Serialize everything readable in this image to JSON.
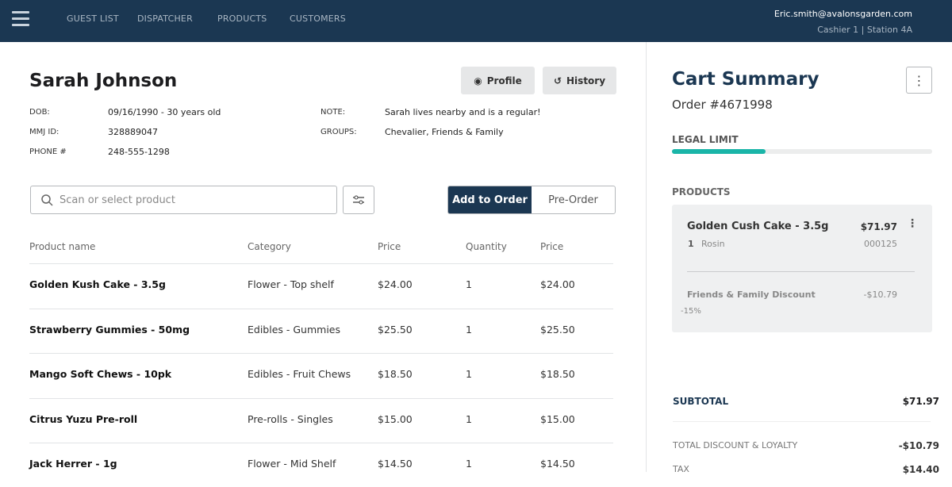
{
  "header": {
    "nav": [
      "GUEST LIST",
      "DISPATCHER",
      "PRODUCTS",
      "CUSTOMERS"
    ],
    "email": "Eric.smith@avalonsgarden.com",
    "station": "Cashier 1 | Station 4A"
  },
  "customer": {
    "name": "Sarah Johnson",
    "profile_label": "Profile",
    "history_label": "History",
    "dob_label": "DOB:",
    "dob": "09/16/1990 - 30 years old",
    "mmj_label": "MMJ ID:",
    "mmj": "328889047",
    "phone_label": "PHONE #",
    "phone": "248-555-1298",
    "note_label": "NOTE:",
    "note": "Sarah lives nearby and is a regular!",
    "groups_label": "GROUPS:",
    "groups": "Chevalier, Friends & Family"
  },
  "search": {
    "placeholder": "Scan or select product"
  },
  "order": {
    "add_label": "Add to Order",
    "preorder_label": "Pre-Order"
  },
  "table": {
    "headers": [
      "Product name",
      "Category",
      "Price",
      "Quantity",
      "Price"
    ],
    "rows": [
      [
        "Golden Kush Cake - 3.5g",
        "Flower - Top shelf",
        "$24.00",
        "1",
        "$24.00"
      ],
      [
        "Strawberry Gummies - 50mg",
        "Edibles - Gummies",
        "$25.50",
        "1",
        "$25.50"
      ],
      [
        "Mango Soft Chews - 10pk",
        "Edibles - Fruit Chews",
        "$18.50",
        "1",
        "$18.50"
      ],
      [
        "Citrus Yuzu Pre-roll",
        "Pre-rolls - Singles",
        "$15.00",
        "1",
        "$15.00"
      ],
      [
        "Jack Herrer - 1g",
        "Flower - Mid Shelf",
        "$14.50",
        "1",
        "$14.50"
      ]
    ]
  },
  "cart": {
    "title": "Cart Summary",
    "order": "Order #4671998",
    "legal_label": "LEGAL LIMIT",
    "legal_fraction": 0.36,
    "products_label": "PRODUCTS",
    "item": {
      "name": "Golden Cush Cake - 3.5g",
      "price": "$71.97",
      "qty": "1",
      "type": "Rosin",
      "sku": "000125"
    },
    "discount": {
      "name": "Friends & Family Discount",
      "amount": "-$10.79",
      "pct": "-15%"
    },
    "subtotal_label": "SUBTOTAL",
    "subtotal": "$71.97",
    "discount_label": "TOTAL DISCOUNT & LOYALTY",
    "discount_total": "-$10.79",
    "tax_label": "TAX",
    "tax": "$14.40"
  },
  "colors": {
    "navy": "#1b3752",
    "teal": "#1ab5a8"
  }
}
